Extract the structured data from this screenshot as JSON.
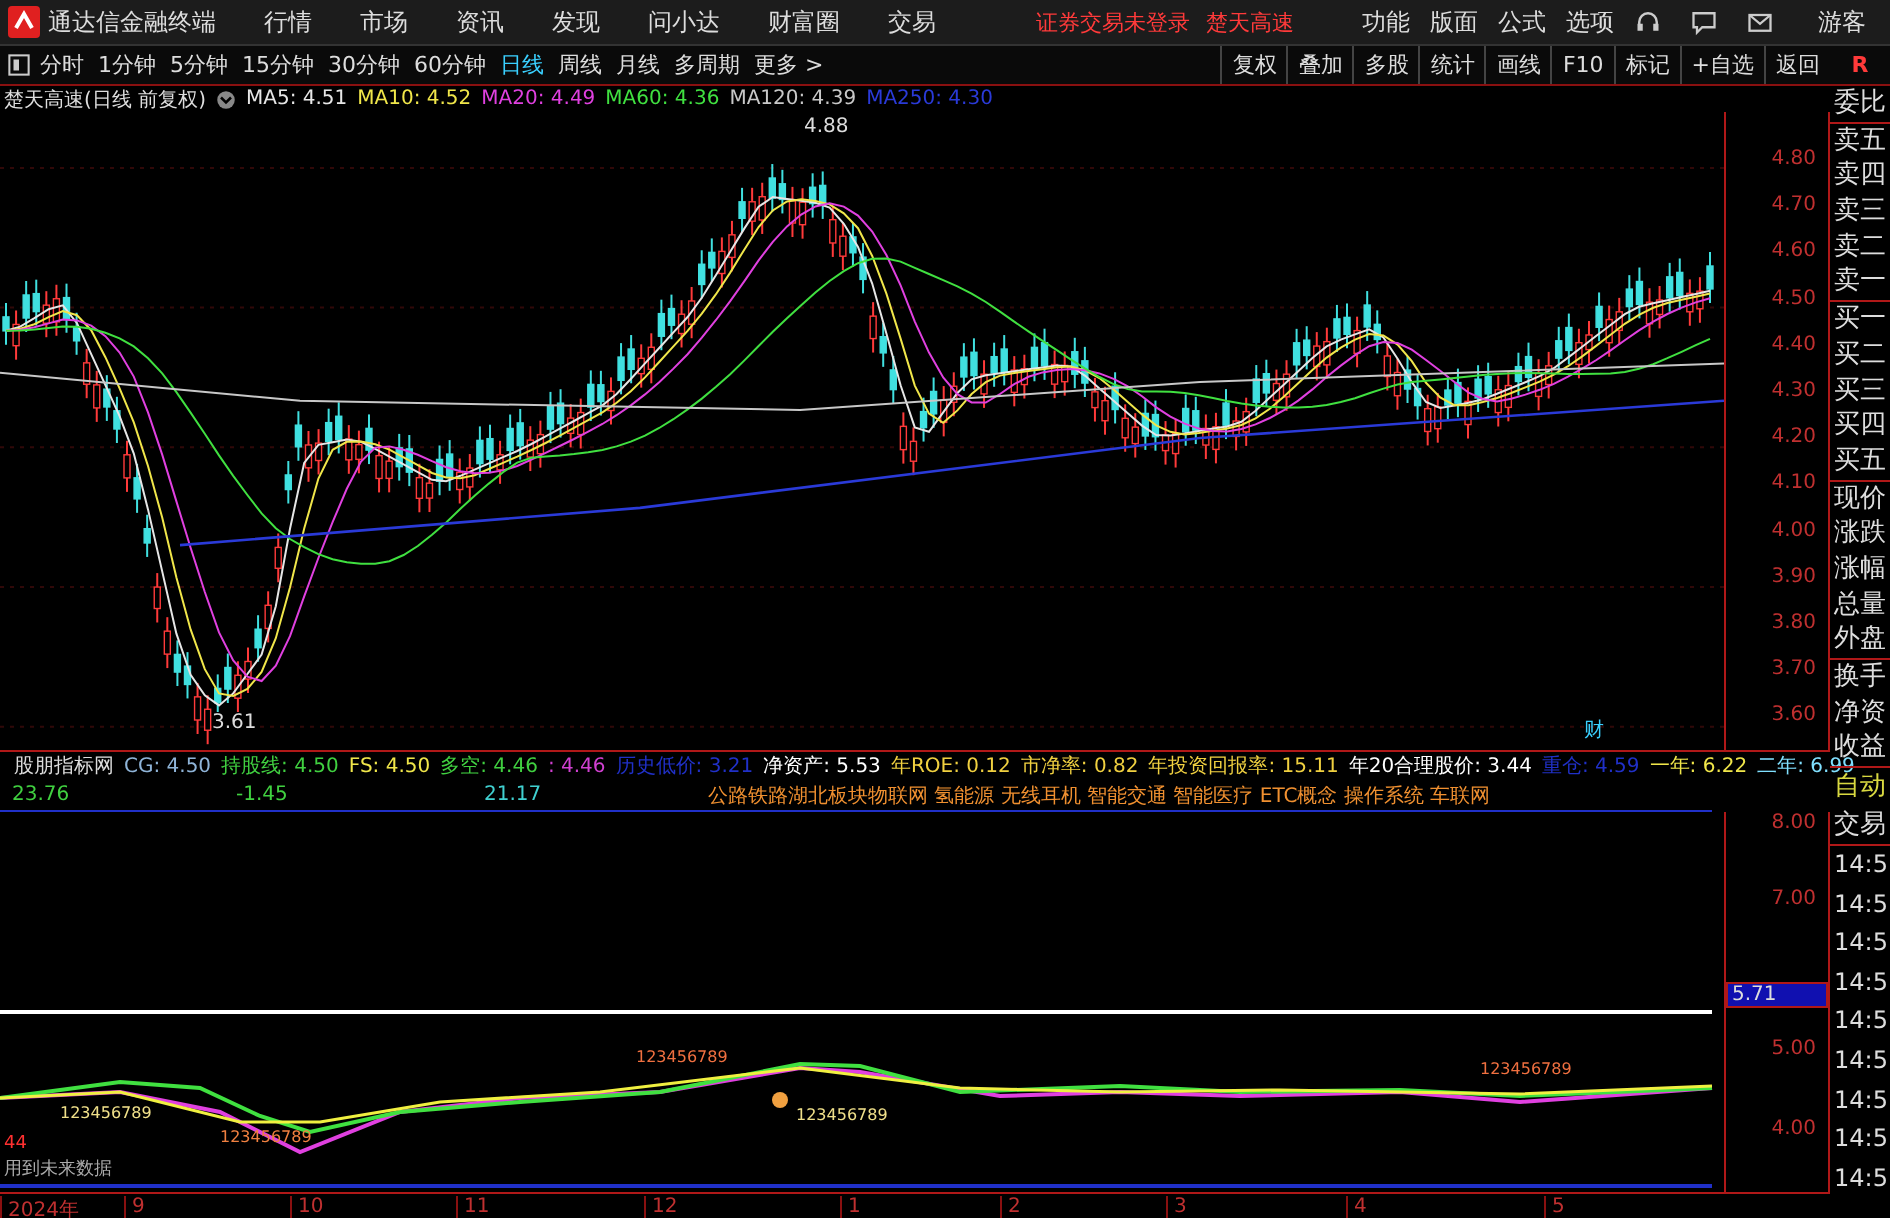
{
  "menu": {
    "app_title": "通达信金融终端",
    "items": [
      "行情",
      "市场",
      "资讯",
      "发现",
      "问小达",
      "财富圈",
      "交易"
    ],
    "notice": "证券交易未登录",
    "stock": "楚天高速",
    "right_items": [
      "功能",
      "版面",
      "公式",
      "选项"
    ],
    "user": "游客"
  },
  "periods": [
    {
      "label": "分时",
      "selected": false
    },
    {
      "label": "1分钟",
      "selected": false
    },
    {
      "label": "5分钟",
      "selected": false
    },
    {
      "label": "15分钟",
      "selected": false
    },
    {
      "label": "30分钟",
      "selected": false
    },
    {
      "label": "60分钟",
      "selected": false
    },
    {
      "label": "日线",
      "selected": true
    },
    {
      "label": "周线",
      "selected": false
    },
    {
      "label": "月线",
      "selected": false
    },
    {
      "label": "多周期",
      "selected": false
    },
    {
      "label": "更多 >",
      "selected": false
    }
  ],
  "tools": [
    "复权",
    "叠加",
    "多股",
    "统计",
    "画线",
    "F10",
    "标记",
    "+自选",
    "返回"
  ],
  "corner": "R",
  "chart_title": "楚天高速(日线 前复权)",
  "mas": [
    {
      "label": "MA5: 4.51",
      "color": "#e6e6e6"
    },
    {
      "label": "MA10: 4.52",
      "color": "#f0e64a"
    },
    {
      "label": "MA20: 4.49",
      "color": "#e040e0"
    },
    {
      "label": "MA60: 4.36",
      "color": "#40e040"
    },
    {
      "label": "MA120: 4.39",
      "color": "#c8c8c8"
    },
    {
      "label": "MA250: 4.30",
      "color": "#2a3ad8"
    }
  ],
  "price_axis": [
    "4.80",
    "4.70",
    "4.60",
    "4.50",
    "4.40",
    "4.30",
    "4.20",
    "4.10",
    "4.00",
    "3.90",
    "3.80",
    "3.70",
    "3.60"
  ],
  "chart_labels": {
    "high": "4.88",
    "low": "3.61",
    "marker": "财"
  },
  "indicator": {
    "name": "股朋指标网",
    "values": [
      {
        "text": "CG: 4.50",
        "color": "#8fb4d8"
      },
      {
        "text": "持股线: 4.50",
        "color": "#40d040"
      },
      {
        "text": "FS: 4.50",
        "color": "#f0e64a"
      },
      {
        "text": "多空: 4.46",
        "color": "#40d040"
      },
      {
        "text": ": 4.46",
        "color": "#d040d0"
      },
      {
        "text": "历史低价: 3.21",
        "color": "#2030c8"
      },
      {
        "text": "净资产: 5.53",
        "color": "#ffffff"
      },
      {
        "text": "年ROE: 0.12",
        "color": "#f0d040"
      },
      {
        "text": "市净率: 0.82",
        "color": "#f0d040"
      },
      {
        "text": "年投资回报率: 15.11",
        "color": "#f0d040"
      },
      {
        "text": "年20合理股价: 3.44",
        "color": "#ffffff"
      },
      {
        "text": "重仓: 4.59",
        "color": "#2030c8"
      },
      {
        "text": "一年: 6.22",
        "color": "#f0e64a"
      },
      {
        "text": "二年: 6.99",
        "color": "#80e0ff"
      }
    ],
    "values_2": [
      {
        "text": "23.76",
        "color": "#40d040"
      },
      {
        "text": "-1.45",
        "color": "#40d040"
      },
      {
        "text": "21.17",
        "color": "#40d0d0"
      }
    ],
    "concepts": "公路铁路湖北板块物联网 氢能源 无线耳机 智能交通 智能医疗 ETC概念 操作系统 车联网",
    "axis": [
      {
        "text": "8.00",
        "highlighted": false
      },
      {
        "text": "7.00",
        "highlighted": false
      },
      {
        "text": "5.71",
        "highlighted": true
      },
      {
        "text": "5.00",
        "highlighted": false
      },
      {
        "text": "4.00",
        "highlighted": false
      }
    ],
    "annotations": [
      "123456789",
      "123456789",
      "123456789",
      "123456789",
      "123456789"
    ],
    "flag": "44",
    "note": "用到未来数据"
  },
  "date_axis": [
    "2024年",
    "9",
    "10",
    "11",
    "12",
    "1",
    "2",
    "3",
    "4",
    "5"
  ],
  "side_panel": {
    "quote_labels": [
      "委比",
      "卖五",
      "卖四",
      "卖三",
      "卖二",
      "卖一",
      "买一",
      "买二",
      "买三",
      "买四",
      "买五",
      "现价",
      "涨跌",
      "涨幅",
      "总量",
      "外盘",
      "换手",
      "净资",
      "收益"
    ],
    "mode": "自动",
    "trade_label": "交易",
    "times": [
      "14:5",
      "14:5",
      "14:5",
      "14:5",
      "14:5",
      "14:5",
      "14:5",
      "14:5",
      "14:5"
    ]
  }
}
